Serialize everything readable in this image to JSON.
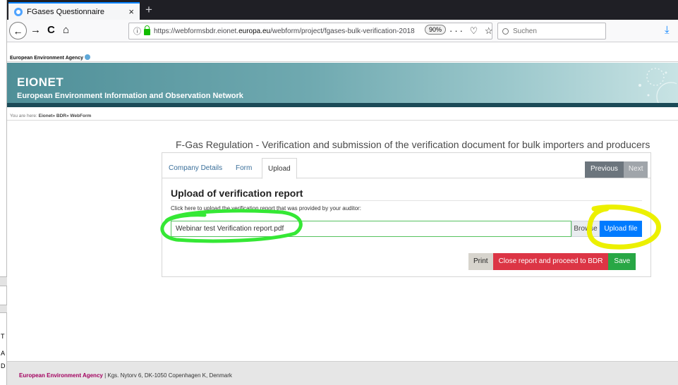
{
  "browser": {
    "tab_title": "FGases Questionnaire",
    "tab_close": "×",
    "new_tab": "+",
    "url_prefix": "https://webformsbdr.eionet.",
    "url_domain": "europa.eu",
    "url_suffix": "/webform/project/fgases-bulk-verification-2018",
    "zoom": "90%",
    "page_actions": "··· ♡ ☆",
    "search_placeholder": "Suchen",
    "back": "←",
    "forward": "→",
    "reload": "C",
    "home": "⌂",
    "download": "⤓"
  },
  "left_window": {
    "letters": [
      "T",
      "A",
      "D"
    ]
  },
  "site": {
    "agency": "European Environment Agency",
    "brand": "EIONET",
    "subtitle": "European Environment Information and Observation Network",
    "breadcrumb_prefix": "You are here: ",
    "breadcrumb_path": "Eionet» BDR» WebForm"
  },
  "form": {
    "title": "F-Gas Regulation - Verification and submission of the verification document for bulk importers and producers",
    "tabs": [
      {
        "label": "Company Details"
      },
      {
        "label": "Form"
      },
      {
        "label": "Upload"
      }
    ],
    "previous": "Previous",
    "next": "Next",
    "heading": "Upload of verification report",
    "instruction": "Click here to upload the verification report that was provided by your auditor:",
    "file_value": "Webinar test Verification report.pdf",
    "browse": "Browse",
    "upload": "Upload file",
    "print": "Print",
    "close_report": "Close report and proceed to BDR",
    "save": "Save"
  },
  "footer": {
    "agency": "European Environment Agency",
    "address": " | Kgs. Nytorv 6, DK-1050 Copenhagen K, Denmark"
  },
  "colors": {
    "annotation_green": "#35e835",
    "annotation_yellow": "#ecf000",
    "primary": "#007bff",
    "danger": "#dc3545",
    "success": "#28a745"
  }
}
